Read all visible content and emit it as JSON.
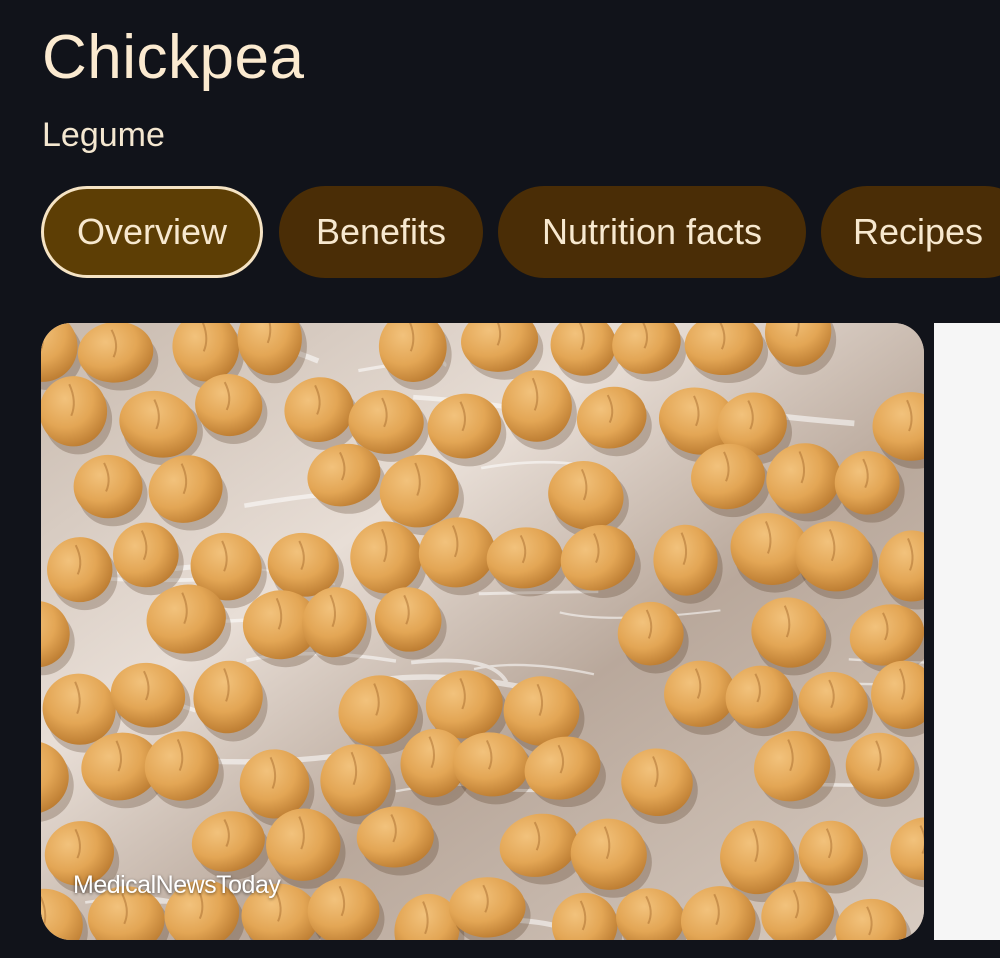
{
  "header": {
    "title": "Chickpea",
    "subtitle": "Legume"
  },
  "tabs": [
    {
      "label": "Overview",
      "active": true
    },
    {
      "label": "Benefits",
      "active": false
    },
    {
      "label": "Nutrition facts",
      "active": false
    },
    {
      "label": "Recipes",
      "active": false
    }
  ],
  "image": {
    "source": "MedicalNewsToday",
    "subject": "chickpea"
  },
  "colors": {
    "background": "#11131a",
    "chip": "#4a2d06",
    "chip_active": "#5d3e05",
    "text": "#f7e8cf"
  }
}
